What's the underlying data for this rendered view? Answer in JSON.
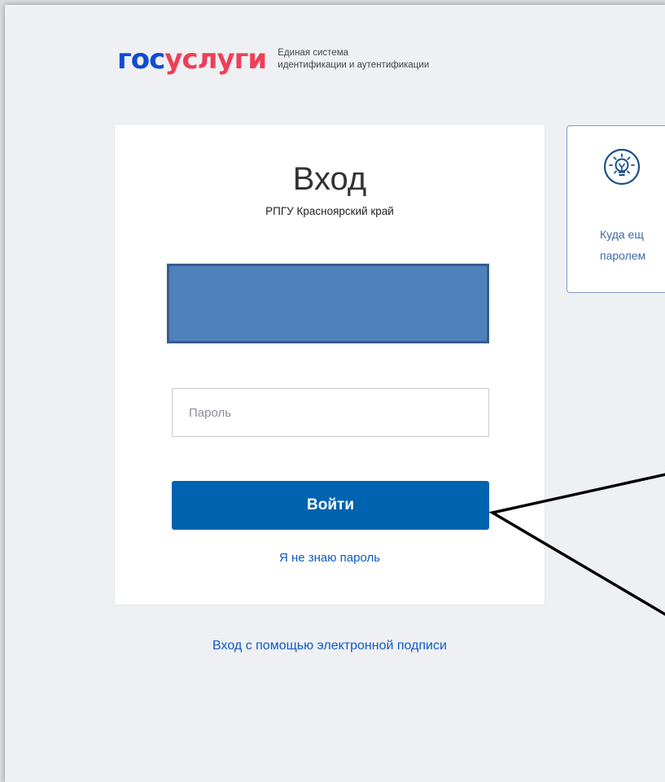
{
  "logo": {
    "part1": "гос",
    "part2": "услуги",
    "subtitle_line1": "Единая система",
    "subtitle_line2": "идентификации и аутентификации"
  },
  "login": {
    "title": "Вход",
    "subtitle": "РПГУ Красноярский край",
    "password_placeholder": "Пароль",
    "submit_label": "Войти",
    "forgot_link": "Я не знаю пароль"
  },
  "esign_link": "Вход с помощью электронной подписи",
  "info_panel": {
    "icon": "lightbulb-icon",
    "line1": "Куда ещ",
    "line2": "паролем"
  },
  "colors": {
    "accent": "#0063b0",
    "logo_blue": "#0d4cd3",
    "logo_red": "#ee3f58",
    "link": "#0d5bbf",
    "redaction": "#4f81bd"
  }
}
